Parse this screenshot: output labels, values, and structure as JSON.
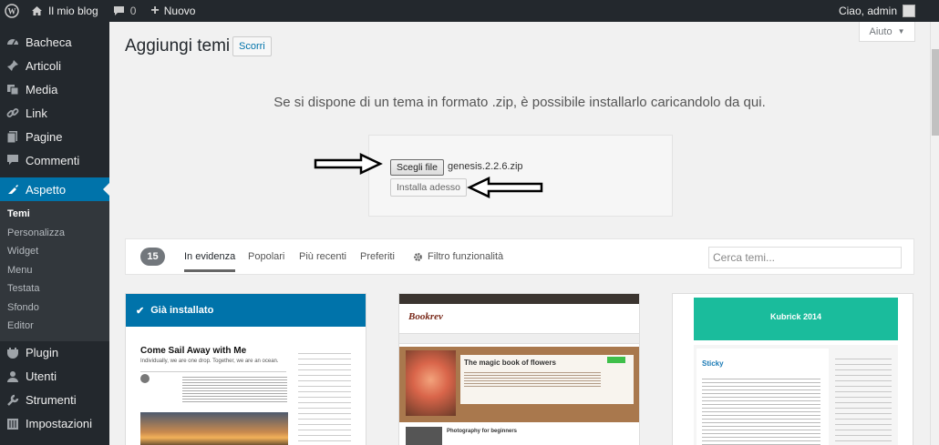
{
  "adminbar": {
    "site_name": "Il mio blog",
    "comments_count": "0",
    "new_label": "Nuovo",
    "greeting": "Ciao, admin"
  },
  "sidebar": {
    "items_top": [
      {
        "label": "Bacheca",
        "icon": "dashboard-icon"
      },
      {
        "label": "Articoli",
        "icon": "pin-icon"
      },
      {
        "label": "Media",
        "icon": "media-icon"
      },
      {
        "label": "Link",
        "icon": "link-icon"
      },
      {
        "label": "Pagine",
        "icon": "pages-icon"
      },
      {
        "label": "Commenti",
        "icon": "comments-icon"
      }
    ],
    "current": {
      "label": "Aspetto",
      "icon": "appearance-icon"
    },
    "submenu": [
      "Temi",
      "Personalizza",
      "Widget",
      "Menu",
      "Testata",
      "Sfondo",
      "Editor"
    ],
    "items_bottom": [
      {
        "label": "Plugin",
        "icon": "plugin-icon"
      },
      {
        "label": "Utenti",
        "icon": "users-icon"
      },
      {
        "label": "Strumenti",
        "icon": "tools-icon"
      },
      {
        "label": "Impostazioni",
        "icon": "settings-icon"
      }
    ]
  },
  "page": {
    "title": "Aggiungi temi",
    "browse_button": "Scorri",
    "help_button": "Aiuto"
  },
  "upload": {
    "instructions": "Se si dispone di un tema in formato .zip, è possibile installarlo caricandolo da qui.",
    "choose_file": "Scegli file",
    "file_name": "genesis.2.2.6.zip",
    "install_button": "Installa adesso"
  },
  "filters": {
    "count": "15",
    "tabs": [
      "In evidenza",
      "Popolari",
      "Più recenti",
      "Preferiti"
    ],
    "active_tab": "In evidenza",
    "feature_filter": "Filtro funzionalità",
    "search_placeholder": "Cerca temi..."
  },
  "themes": {
    "installed_label": "Già installato",
    "card1": {
      "headline": "Come Sail Away with Me",
      "tagline": "Individually, we are one drop. Together, we are an ocean."
    },
    "card2": {
      "site_title": "Bookrev",
      "post_title": "The magic book of flowers",
      "second_post": "Photography for beginners"
    },
    "card3": {
      "site_title": "Kubrick 2014",
      "post_title": "Sticky"
    }
  },
  "colors": {
    "adminbar_bg": "#23282d",
    "accent": "#0073aa",
    "kubrick_header": "#1abc9c"
  }
}
